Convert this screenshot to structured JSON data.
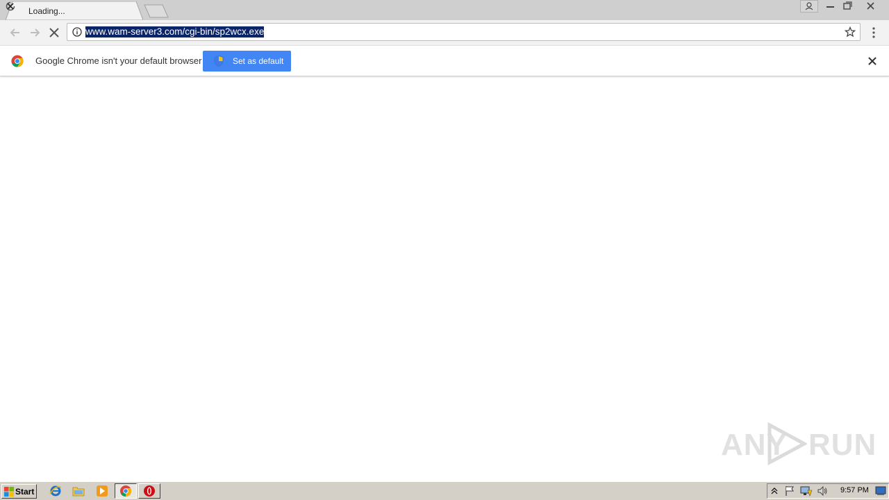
{
  "browser": {
    "tab": {
      "title": "Loading..."
    },
    "address_bar": {
      "url": "www.wam-server3.com/cgi-bin/sp2wcx.exe"
    }
  },
  "infobar": {
    "message": "Google Chrome isn't your default browser",
    "button_label": "Set as default"
  },
  "watermark": {
    "left": "ANY",
    "right": "RUN"
  },
  "taskbar": {
    "start_label": "Start",
    "clock": "9:57 PM"
  },
  "colors": {
    "accent_button": "#4285f4",
    "url_selection": "#0a246a"
  },
  "icons": [
    "loading-spinner-icon",
    "close-icon",
    "back-icon",
    "forward-icon",
    "stop-icon",
    "info-icon",
    "star-icon",
    "menu-icon",
    "chrome-logo-icon",
    "shield-icon",
    "windows-logo-icon",
    "ie-icon",
    "folder-icon",
    "media-player-icon",
    "chrome-icon",
    "opera-icon",
    "tray-arrow-icon",
    "flag-icon",
    "network-icon",
    "volume-icon",
    "show-desktop-icon"
  ]
}
